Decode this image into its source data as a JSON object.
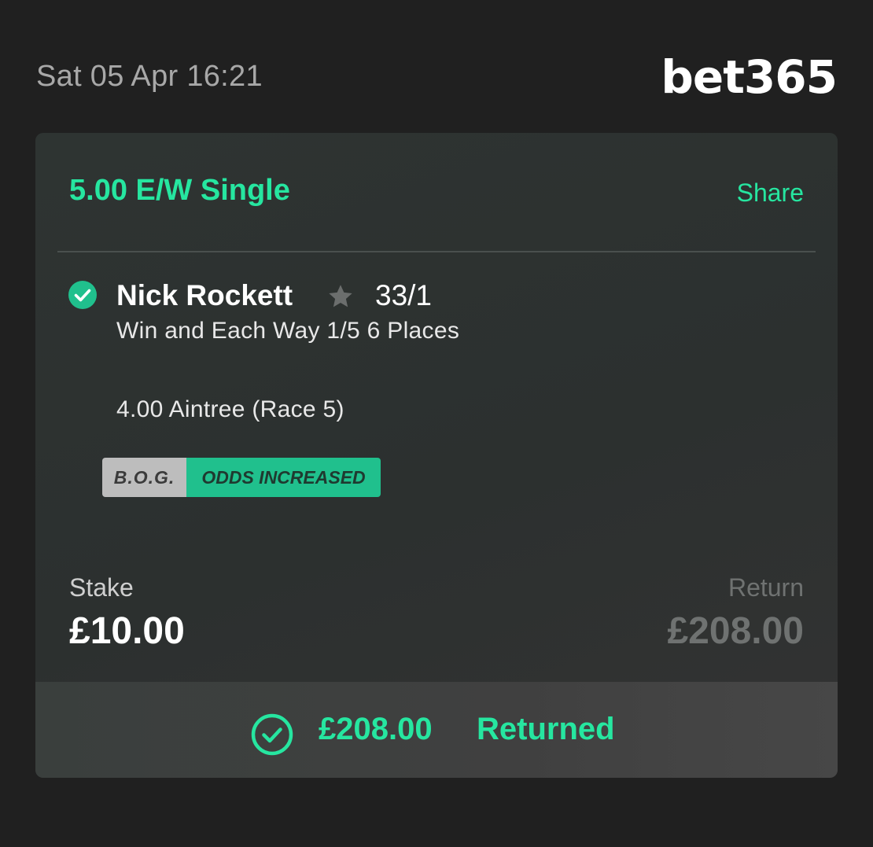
{
  "header": {
    "timestamp": "Sat 05 Apr 16:21",
    "logo_text": "bet365"
  },
  "bet": {
    "type": "5.00 E/W Single",
    "share_label": "Share",
    "selection": {
      "name": "Nick Rockett",
      "odds": "33/1",
      "market": "Win and Each Way 1/5 6 Places",
      "event": "4.00 Aintree (Race 5)",
      "status_icon": "check-circle-icon",
      "favourite_icon": "star-icon"
    },
    "badges": {
      "bog": "B.O.G.",
      "odds_increased": "ODDS INCREASED"
    },
    "stake": {
      "label": "Stake",
      "value": "£10.00"
    },
    "return": {
      "label": "Return",
      "value": "£208.00"
    },
    "footer": {
      "amount": "£208.00",
      "status": "Returned",
      "icon": "check-circle-outline-icon"
    }
  },
  "colors": {
    "accent": "#26e6a0",
    "background": "#202020",
    "card": "#2e3432",
    "badge_green": "#20c08d",
    "badge_grey": "#bdbdbd"
  }
}
